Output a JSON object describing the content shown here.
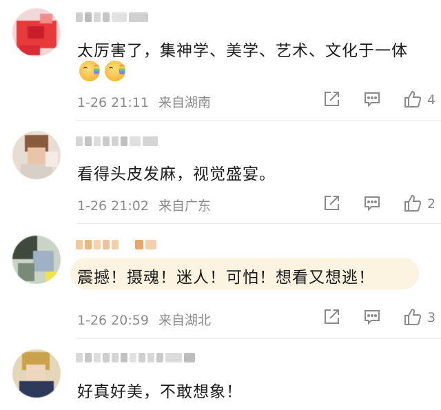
{
  "comments": [
    {
      "text": "太厉害了，集神学、美学、艺术、文化于一体",
      "emoji": [
        "rainbow-vomit-emoji",
        "rainbow-vomit-emoji"
      ],
      "time": "1-26 21:11",
      "location": "来自湖南",
      "likes": "4"
    },
    {
      "text": "看得头皮发麻，视觉盛宴。",
      "time": "1-26 21:02",
      "location": "来自广东",
      "likes": "2"
    },
    {
      "text": "震撼！摄魂！迷人！可怕！想看又想逃！",
      "time": "1-26 20:59",
      "location": "来自湖北",
      "likes": "3"
    },
    {
      "text": "好真好美，不敢想象！"
    }
  ],
  "colors": {
    "text": "#1c1c1c",
    "meta": "#8a8a8a",
    "highlight": "#fdf3e1",
    "divider": "#ececec"
  }
}
